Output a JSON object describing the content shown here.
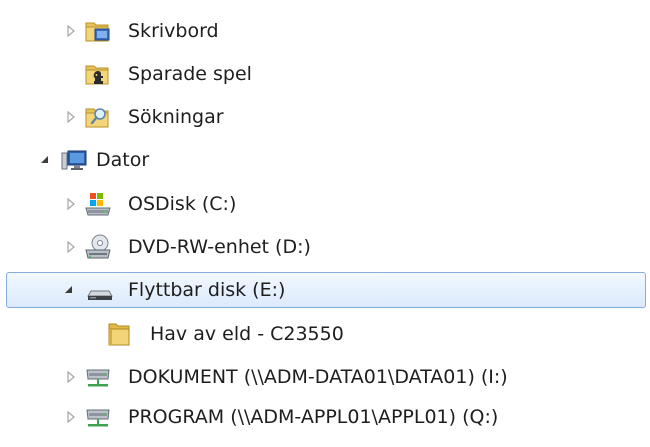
{
  "tree": {
    "items": [
      {
        "label": "Skrivbord",
        "icon": "desktop-folder-icon",
        "expander": "collapsed"
      },
      {
        "label": "Sparade spel",
        "icon": "saved-games-folder-icon",
        "expander": "none"
      },
      {
        "label": "Sökningar",
        "icon": "searches-folder-icon",
        "expander": "collapsed"
      },
      {
        "label": "Dator",
        "icon": "computer-icon",
        "expander": "expanded"
      },
      {
        "label": "OSDisk (C:)",
        "icon": "os-disk-icon",
        "expander": "collapsed"
      },
      {
        "label": "DVD-RW-enhet (D:)",
        "icon": "dvd-drive-icon",
        "expander": "collapsed"
      },
      {
        "label": "Flyttbar disk (E:)",
        "icon": "removable-disk-icon",
        "expander": "expanded",
        "selected": true
      },
      {
        "label": "Hav av eld - C23550",
        "icon": "folder-icon",
        "expander": "none"
      },
      {
        "label": "DOKUMENT (\\\\ADM-DATA01\\DATA01) (I:)",
        "icon": "network-drive-icon",
        "expander": "collapsed"
      },
      {
        "label": "PROGRAM (\\\\ADM-APPL01\\APPL01) (Q:)",
        "icon": "network-drive-icon",
        "expander": "collapsed"
      }
    ]
  },
  "colors": {
    "selection_border": "#84acdd",
    "selection_fill": "#dceafc",
    "text": "#1e1e1e",
    "folder": "#e8c25a"
  }
}
